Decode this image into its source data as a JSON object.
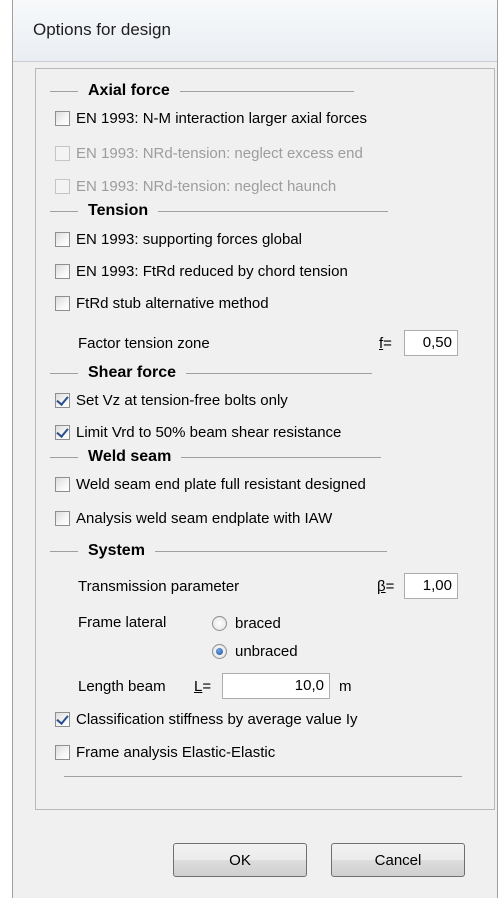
{
  "window": {
    "title": "Options for design"
  },
  "sections": {
    "axial": "Axial force",
    "tension": "Tension",
    "shear": "Shear force",
    "weld": "Weld seam",
    "system": "System"
  },
  "axial": {
    "nm_interaction": {
      "label": "EN 1993: N-M interaction larger axial forces",
      "checked": false
    },
    "nrd_excess_end": {
      "label": "EN 1993: NRd-tension: neglect excess end",
      "checked": false,
      "enabled": false
    },
    "nrd_haunch": {
      "label": "EN 1993: NRd-tension: neglect haunch",
      "checked": false,
      "enabled": false
    }
  },
  "tension": {
    "supporting_forces": {
      "label": "EN 1993: supporting forces global",
      "checked": false
    },
    "ftrd_chord": {
      "label": "EN 1993: FtRd reduced by chord tension",
      "checked": false
    },
    "ftrd_stub": {
      "label": "FtRd stub alternative method",
      "checked": false
    },
    "factor_label": "Factor tension zone",
    "factor_symbol": "f",
    "factor_eq": "=",
    "factor_value": "0,50"
  },
  "shear": {
    "vz_tension_free": {
      "label": "Set Vz at tension-free bolts only",
      "checked": true
    },
    "limit_vrd": {
      "label": "Limit Vrd to 50% beam shear resistance",
      "checked": true
    }
  },
  "weld": {
    "end_plate_full": {
      "label": "Weld seam end plate full resistant designed",
      "checked": false
    },
    "endplate_iaw": {
      "label": "Analysis weld seam endplate with IAW",
      "checked": false
    }
  },
  "system": {
    "transmission_label": "Transmission parameter",
    "beta_symbol": "β",
    "beta_eq": "=",
    "beta_value": "1,00",
    "frame_lateral_label": "Frame lateral",
    "braced": "braced",
    "unbraced": "unbraced",
    "selected": "unbraced",
    "length_label": "Length beam",
    "length_symbol": "L",
    "length_eq": "=",
    "length_value": "10,0",
    "length_unit": "m",
    "classification": {
      "label": "Classification stiffness by  average value Iy",
      "checked": true
    },
    "frame_analysis": {
      "label": "Frame analysis Elastic-Elastic",
      "checked": false
    }
  },
  "buttons": {
    "ok": "OK",
    "cancel": "Cancel"
  }
}
